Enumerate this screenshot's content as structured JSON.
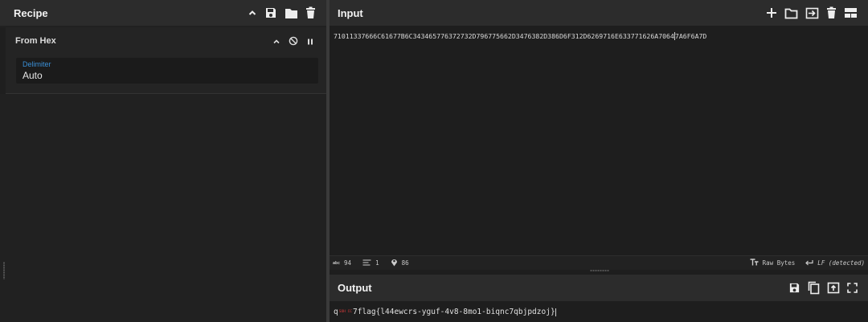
{
  "recipe": {
    "title": "Recipe",
    "icons": [
      "chevron-up-icon",
      "save-icon",
      "folder-icon",
      "trash-icon"
    ],
    "operation": {
      "name": "From Hex",
      "icons": [
        "chevron-up-icon",
        "disable-icon",
        "pause-icon"
      ],
      "arg_label": "Delimiter",
      "arg_value": "Auto"
    }
  },
  "input": {
    "title": "Input",
    "icons": [
      "plus-icon",
      "folder-icon",
      "import-icon",
      "trash-icon",
      "layout-icon"
    ],
    "text_before_caret": "71011337666C61677B6C343465776372732D796775662D3476382D386D6F312D6269716E633771626A7064",
    "text_after_caret": "7A6F6A7D",
    "status": {
      "length_label": "abc",
      "length": "94",
      "lines": "1",
      "position": "86",
      "encoding": "Raw Bytes",
      "eol": "LF (detected)"
    }
  },
  "output": {
    "title": "Output",
    "icons": [
      "save-icon",
      "copy-icon",
      "replace-input-icon",
      "maximize-icon"
    ],
    "prefix": "q",
    "control_char": "SOH CC",
    "text": "7flag{l44ewcrs-yguf-4v8-8mo1-biqnc7qbjpdzoj}"
  },
  "colors": {
    "accent": "#3a8fd6",
    "control_char": "#d83a3a",
    "header_bg": "#2c2c2c",
    "panel_bg": "#1e1e1e"
  }
}
